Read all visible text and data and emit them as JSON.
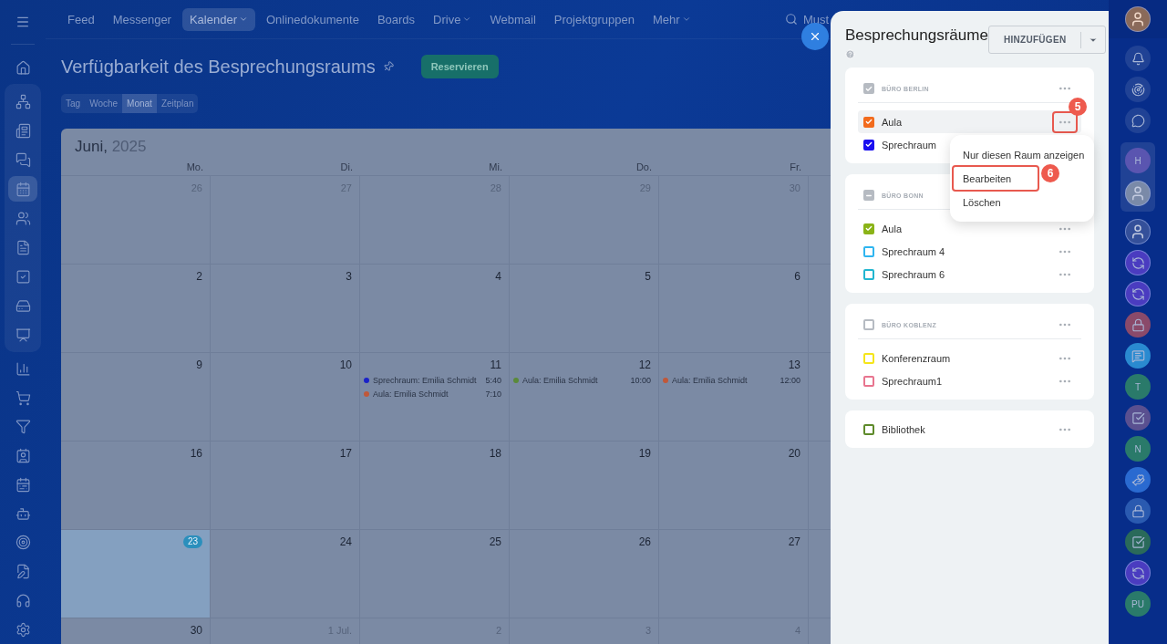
{
  "sidebar": {
    "top": [
      {
        "selected": false
      }
    ],
    "pinned": [
      {
        "selected": false
      },
      {
        "selected": false
      },
      {
        "selected": false
      },
      {
        "selected": true
      },
      {
        "selected": false
      },
      {
        "selected": false
      },
      {
        "selected": false
      },
      {
        "selected": false
      },
      {
        "selected": false
      }
    ],
    "more": [
      {
        "selected": false
      },
      {
        "selected": false
      },
      {
        "selected": false
      },
      {
        "selected": false
      },
      {
        "selected": false
      },
      {
        "selected": false
      },
      {
        "selected": false
      },
      {
        "selected": false
      },
      {
        "selected": false
      },
      {
        "selected": false
      }
    ]
  },
  "top_nav": {
    "items": [
      {
        "label": "Feed",
        "selected": false,
        "dropdown": false
      },
      {
        "label": "Messenger",
        "selected": false,
        "dropdown": false
      },
      {
        "label": "Kalender",
        "selected": true,
        "dropdown": true
      },
      {
        "label": "Onlinedokumente",
        "selected": false,
        "dropdown": false
      },
      {
        "label": "Boards",
        "selected": false,
        "dropdown": false
      },
      {
        "label": "Drive",
        "selected": false,
        "dropdown": true
      },
      {
        "label": "Webmail",
        "selected": false,
        "dropdown": false
      },
      {
        "label": "Projektgruppen",
        "selected": false,
        "dropdown": false
      },
      {
        "label": "Mehr",
        "selected": false,
        "dropdown": true
      }
    ],
    "search": {
      "value": "Must"
    }
  },
  "page": {
    "title": "Verfügbarkeit des Besprechungsraums",
    "action": "Reservieren",
    "views": [
      {
        "label": "Tag",
        "selected": false
      },
      {
        "label": "Woche",
        "selected": false
      },
      {
        "label": "Monat",
        "selected": true
      },
      {
        "label": "Zeitplan",
        "selected": false
      }
    ]
  },
  "calendar": {
    "month": "Juni,",
    "year": "2025",
    "weekdays": [
      "Mo.",
      "Di.",
      "Mi.",
      "Do.",
      "Fr."
    ],
    "weeks": [
      [
        {
          "day": "26",
          "other_month": true,
          "today": false
        },
        {
          "day": "27",
          "other_month": true,
          "today": false
        },
        {
          "day": "28",
          "other_month": true,
          "today": false
        },
        {
          "day": "29",
          "other_month": true,
          "today": false
        },
        {
          "day": "30",
          "other_month": true,
          "today": false
        }
      ],
      [
        {
          "day": "2",
          "other_month": false,
          "today": false
        },
        {
          "day": "3",
          "other_month": false,
          "today": false
        },
        {
          "day": "4",
          "other_month": false,
          "today": false
        },
        {
          "day": "5",
          "other_month": false,
          "today": false
        },
        {
          "day": "6",
          "other_month": false,
          "today": false
        }
      ],
      [
        {
          "day": "9",
          "other_month": false,
          "today": false
        },
        {
          "day": "10",
          "other_month": false,
          "today": false
        },
        {
          "day": "11",
          "other_month": false,
          "today": false,
          "events": [
            {
              "title": "Sprechraum: Emilia Schmidt",
              "time": "5:40",
              "color": "#1a22c8"
            },
            {
              "title": "Aula: Emilia Schmidt",
              "time": "7:10",
              "color": "#c0583a"
            }
          ]
        },
        {
          "day": "12",
          "other_month": false,
          "today": false,
          "events": [
            {
              "title": "Aula: Emilia Schmidt",
              "time": "10:00",
              "color": "#5a8a3a"
            }
          ]
        },
        {
          "day": "13",
          "other_month": false,
          "today": false,
          "events": [
            {
              "title": "Aula: Emilia Schmidt",
              "time": "12:00",
              "color": "#c0583a"
            }
          ]
        }
      ],
      [
        {
          "day": "16",
          "other_month": false,
          "today": false
        },
        {
          "day": "17",
          "other_month": false,
          "today": false
        },
        {
          "day": "18",
          "other_month": false,
          "today": false
        },
        {
          "day": "19",
          "other_month": false,
          "today": false
        },
        {
          "day": "20",
          "other_month": false,
          "today": false
        }
      ],
      [
        {
          "day": "23",
          "other_month": false,
          "today": true
        },
        {
          "day": "24",
          "other_month": false,
          "today": false
        },
        {
          "day": "25",
          "other_month": false,
          "today": false
        },
        {
          "day": "26",
          "other_month": false,
          "today": false
        },
        {
          "day": "27",
          "other_month": false,
          "today": false
        }
      ],
      [
        {
          "day": "30",
          "other_month": false,
          "today": false
        },
        {
          "day": "1 Jul.",
          "other_month": true,
          "today": false
        },
        {
          "day": "2",
          "other_month": true,
          "today": false
        },
        {
          "day": "3",
          "other_month": true,
          "today": false
        },
        {
          "day": "4",
          "other_month": true,
          "today": false
        }
      ]
    ]
  },
  "rooms_panel": {
    "title": "Besprechungsräume",
    "add_button": "HINZUFÜGEN",
    "groups": [
      {
        "name": "BÜRO BERLIN",
        "checked": true,
        "indeterminate": false,
        "rooms": [
          {
            "name": "Aula",
            "color": "#f26b1d",
            "checked": true,
            "selected": true,
            "marker": "5"
          },
          {
            "name": "Sprechraum",
            "color": "#1a0ff0",
            "checked": true,
            "selected": false
          }
        ]
      },
      {
        "name": "BÜRO BONN",
        "checked": true,
        "indeterminate": true,
        "rooms": [
          {
            "name": "Aula",
            "color": "#8ab317",
            "checked": true,
            "selected": false
          },
          {
            "name": "Sprechraum 4",
            "color": "#2fb5f0",
            "checked": false,
            "selected": false
          },
          {
            "name": "Sprechraum 6",
            "color": "#21b6d0",
            "checked": false,
            "selected": false
          }
        ]
      },
      {
        "name": "BÜRO KOBLENZ",
        "checked": false,
        "indeterminate": false,
        "rooms": [
          {
            "name": "Konferenzraum",
            "color": "#f5e51a",
            "checked": false,
            "selected": false
          },
          {
            "name": "Sprechraum1",
            "color": "#e8758f",
            "checked": false,
            "selected": false
          }
        ]
      },
      {
        "rooms": [
          {
            "name": "Bibliothek",
            "color": "#5e8a2a",
            "checked": false,
            "selected": false
          }
        ]
      }
    ],
    "menu": [
      {
        "label": "Nur diesen Raum anzeigen",
        "selected": false
      },
      {
        "label": "Bearbeiten",
        "selected": true,
        "marker": "6"
      },
      {
        "label": "Löschen",
        "selected": false
      }
    ]
  },
  "right_bar": {
    "pinned": [
      {
        "kind": "letter",
        "text": "H",
        "color": "#5a55b0"
      },
      {
        "kind": "photo",
        "color": "#7a8aa8"
      }
    ],
    "tools": [
      {
        "kind": "bell"
      },
      {
        "kind": "radar"
      },
      {
        "kind": "chat"
      }
    ],
    "chats": [
      {
        "kind": "photo",
        "color": "#34509a"
      },
      {
        "kind": "cycle",
        "color": "#4a3cc0"
      },
      {
        "kind": "cycle",
        "color": "#4a3cc0"
      },
      {
        "kind": "lock",
        "color": "#8a4a6a"
      },
      {
        "kind": "messages",
        "color": "#2a8ad0"
      },
      {
        "kind": "letter",
        "text": "T",
        "color": "#2a7a6a"
      },
      {
        "kind": "task",
        "color": "#5a5090"
      },
      {
        "kind": "letter",
        "text": "N",
        "color": "#2a7a6a"
      },
      {
        "kind": "team",
        "color": "#2a6ad0"
      },
      {
        "kind": "lock",
        "color": "#2a5ab0"
      },
      {
        "kind": "task",
        "color": "#2a6a5a"
      },
      {
        "kind": "cycle",
        "color": "#4a3cc0"
      },
      {
        "kind": "letter",
        "text": "PU",
        "color": "#2a7a6a"
      }
    ]
  }
}
